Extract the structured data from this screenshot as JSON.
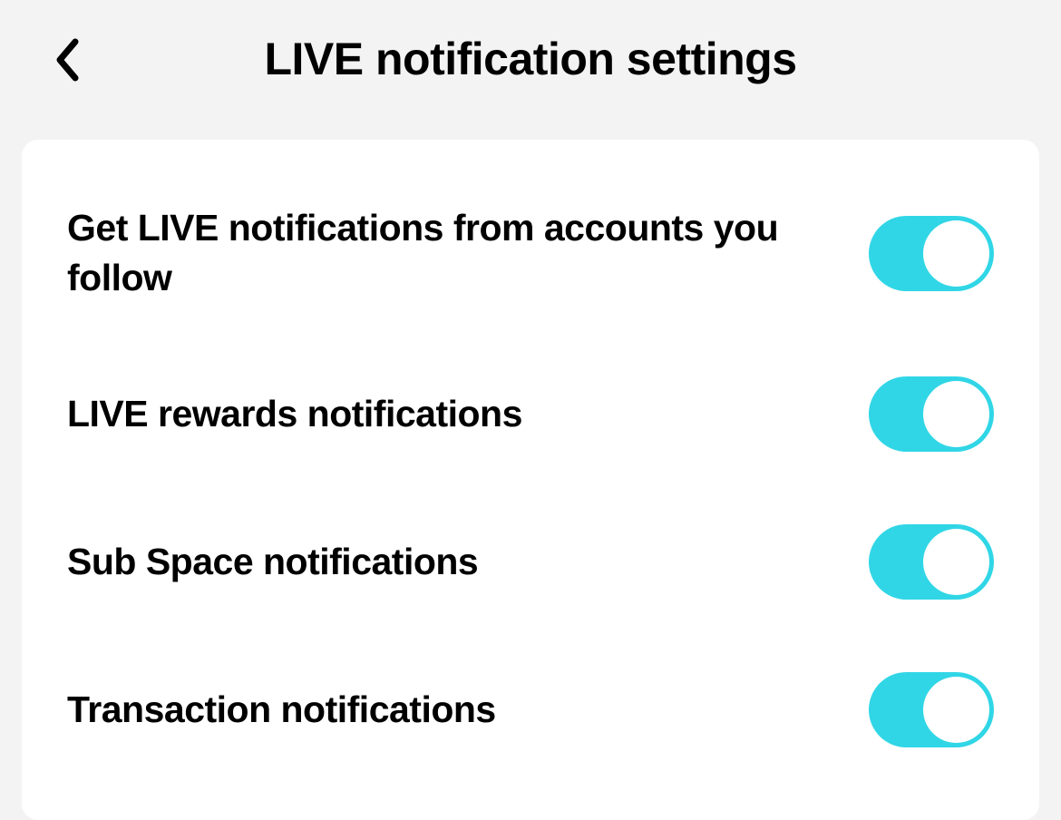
{
  "header": {
    "title": "LIVE notification settings"
  },
  "settings": {
    "items": [
      {
        "label": "Get LIVE notifications from accounts you follow",
        "on": true
      },
      {
        "label": "LIVE rewards notifications",
        "on": true
      },
      {
        "label": "Sub Space notifications",
        "on": true
      },
      {
        "label": "Transaction notifications",
        "on": true
      }
    ]
  },
  "colors": {
    "toggle_on": "#30d6e6",
    "background": "#f3f3f3",
    "card": "#ffffff"
  }
}
